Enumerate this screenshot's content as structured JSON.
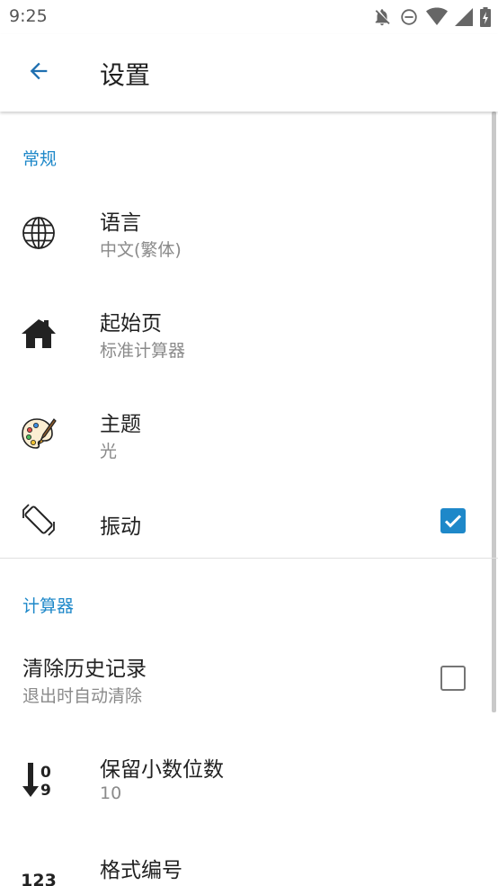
{
  "status_bar": {
    "time": "9:25",
    "icons": [
      "notifications-off-icon",
      "do-not-disturb-icon",
      "wifi-icon",
      "signal-icon",
      "battery-charging-icon"
    ]
  },
  "app_bar": {
    "title": "设置",
    "back_icon": "arrow-back-icon"
  },
  "colors": {
    "accent": "#1e88c9",
    "text_primary": "#222222",
    "text_secondary": "#8a8a8a"
  },
  "sections": {
    "general": {
      "header": "常规",
      "items": {
        "language": {
          "title": "语言",
          "summary": "中文(繁体)",
          "icon": "globe-icon"
        },
        "start_page": {
          "title": "起始页",
          "summary": "标准计算器",
          "icon": "home-icon"
        },
        "theme": {
          "title": "主题",
          "summary": "光",
          "icon": "palette-icon"
        },
        "vibration": {
          "title": "振动",
          "icon": "vibration-icon",
          "checked": true
        }
      }
    },
    "calculator": {
      "header": "计算器",
      "items": {
        "clear_history": {
          "title": "清除历史记录",
          "summary": "退出时自动清除",
          "checked": false
        },
        "decimal_places": {
          "title": "保留小数位数",
          "summary": "10",
          "icon": "sort-numeric-icon"
        },
        "number_format": {
          "title": "格式编号",
          "icon": "numeric-123-icon",
          "icon_text": "123"
        }
      }
    }
  }
}
